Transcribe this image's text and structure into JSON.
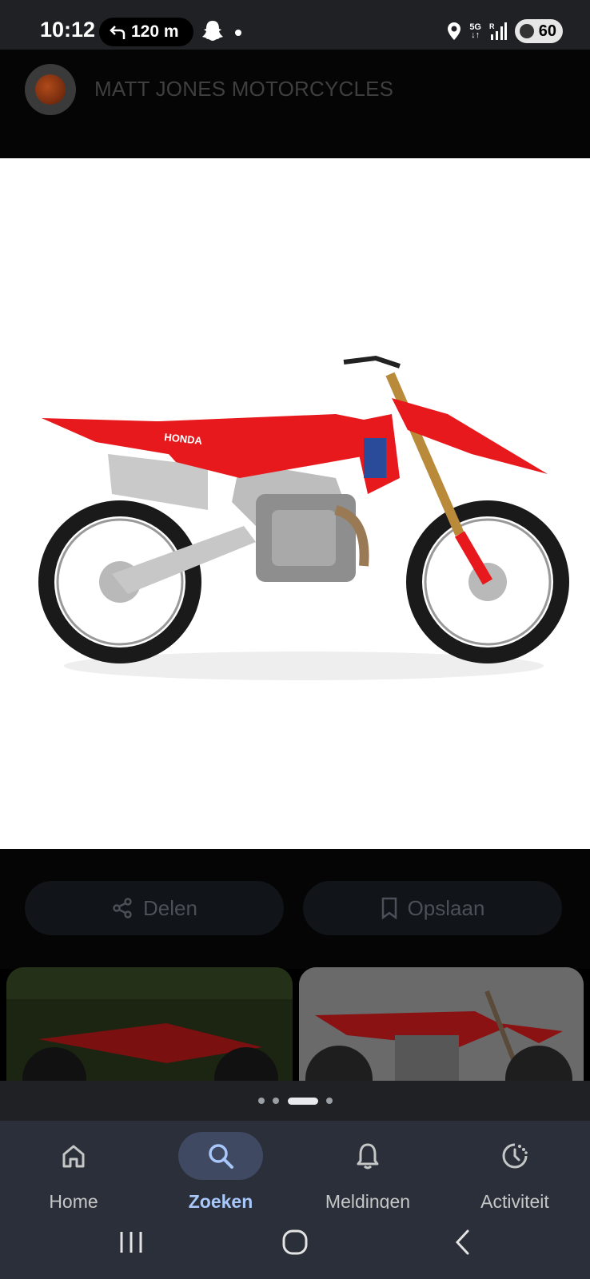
{
  "status_bar": {
    "time": "10:12",
    "navigation_distance": "120 m",
    "network": "5G",
    "battery": "60",
    "icons": [
      "turn-left-arrow-icon",
      "snapchat-ghost-icon",
      "notification-dot",
      "location-icon",
      "5g-icon",
      "signal-icon",
      "battery-icon"
    ]
  },
  "header": {
    "source_name": "MATT JONES MOTORCYCLES"
  },
  "main_image": {
    "subject": "red dirt bike",
    "accent_color": "#e8191d"
  },
  "actions": {
    "share_label": "Delen",
    "save_label": "Opslaan"
  },
  "pager": {
    "count": 4,
    "active_index": 2
  },
  "bottom_nav": {
    "items": [
      {
        "label": "Home",
        "icon": "home-icon",
        "active": false
      },
      {
        "label": "Zoeken",
        "icon": "search-icon",
        "active": true
      },
      {
        "label": "Meldingen",
        "icon": "bell-icon",
        "active": false
      },
      {
        "label": "Activiteit",
        "icon": "activity-icon",
        "active": false
      }
    ]
  },
  "system_nav": {
    "icons": [
      "recents-icon",
      "home-circle-icon",
      "back-icon"
    ]
  },
  "colors": {
    "active_nav": "#a8c7fa",
    "nav_bg": "#2a2f3a",
    "bike_red": "#e8191d"
  }
}
